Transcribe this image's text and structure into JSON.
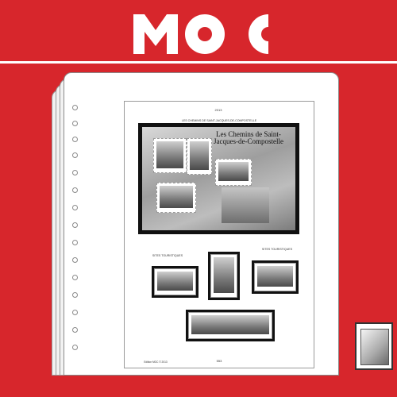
{
  "brand": {
    "logo_text": "MOC",
    "background_color": "#d7262c",
    "logo_color": "#ffffff"
  },
  "album_page": {
    "year": "2013",
    "souvenir_sheet_caption": "LES CHEMINS DE SAINT-JACQUES-DE-COMPOSTELLE",
    "sheet_title": "Les Chemins de Saint-Jacques-de-Compostelle",
    "left_group_caption": "SITES TOURISTIQUES",
    "right_group_caption": "SITES TOURISTIQUES",
    "footer_left": "Edition MOC © 2013",
    "page_number": "553"
  },
  "corner_badge": {
    "icon": "album-mount-icon"
  }
}
